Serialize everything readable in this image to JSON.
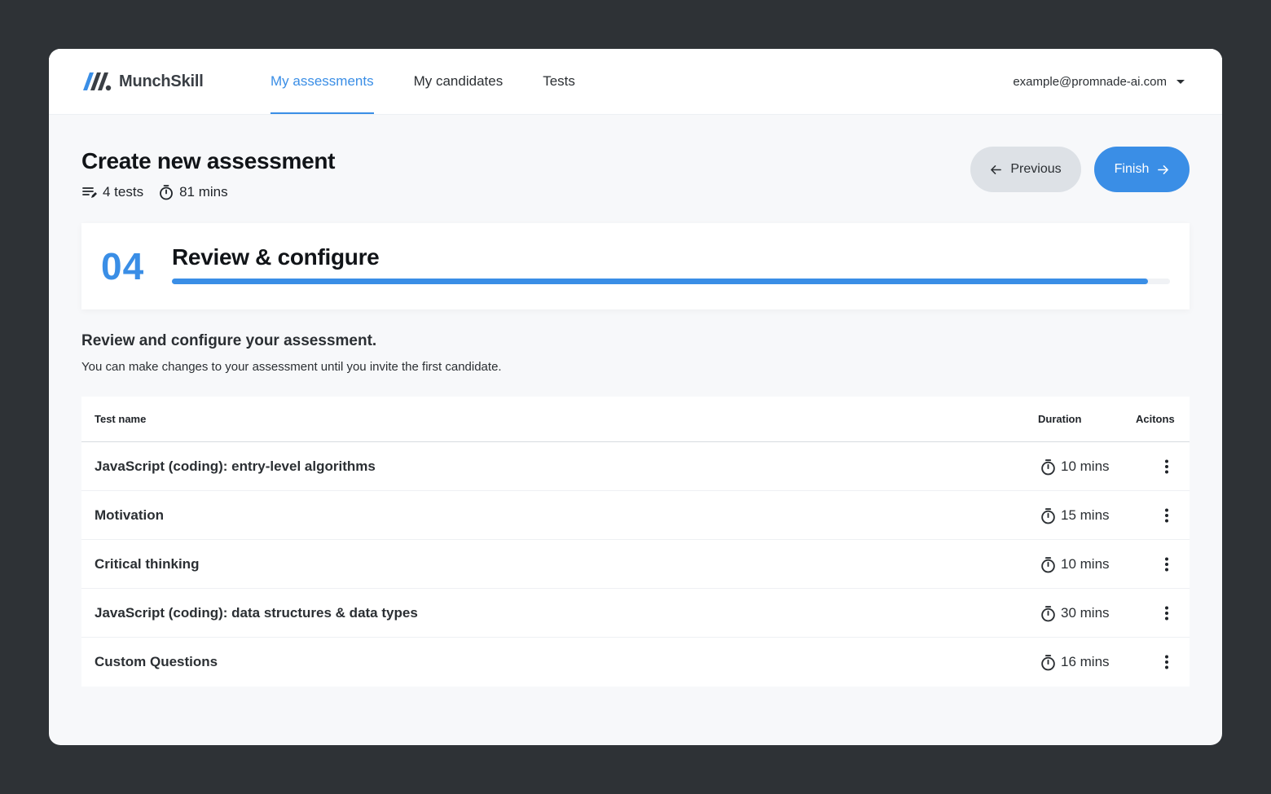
{
  "brand": {
    "name": "MunchSkill",
    "color": "#3a8ee6"
  },
  "nav": {
    "items": [
      {
        "label": "My assessments",
        "active": true
      },
      {
        "label": "My candidates",
        "active": false
      },
      {
        "label": "Tests",
        "active": false
      }
    ]
  },
  "account": {
    "email": "example@promnade-ai.com"
  },
  "page": {
    "title": "Create new assessment",
    "tests_count": "4 tests",
    "total_duration": "81 mins",
    "previous_label": "Previous",
    "finish_label": "Finish"
  },
  "step": {
    "number": "04",
    "title": "Review & configure",
    "progress_fraction": 0.978
  },
  "section": {
    "title": "Review and configure your assessment.",
    "subtitle": "You can make changes to your assessment until you invite the first candidate."
  },
  "table": {
    "headers": {
      "name": "Test name",
      "duration": "Duration",
      "actions": "Acitons"
    },
    "rows": [
      {
        "name": "JavaScript (coding): entry-level algorithms",
        "duration": "10 mins"
      },
      {
        "name": "Motivation",
        "duration": "15 mins"
      },
      {
        "name": "Critical thinking",
        "duration": "10 mins"
      },
      {
        "name": "JavaScript (coding): data structures & data types",
        "duration": "30 mins"
      },
      {
        "name": "Custom Questions",
        "duration": "16 mins"
      }
    ]
  },
  "icons": {
    "tests": "list-edit-icon",
    "timer": "stopwatch-icon",
    "previous": "arrow-left-icon",
    "finish": "arrow-right-icon",
    "actions": "more-vertical-icon",
    "account": "caret-down-icon"
  }
}
